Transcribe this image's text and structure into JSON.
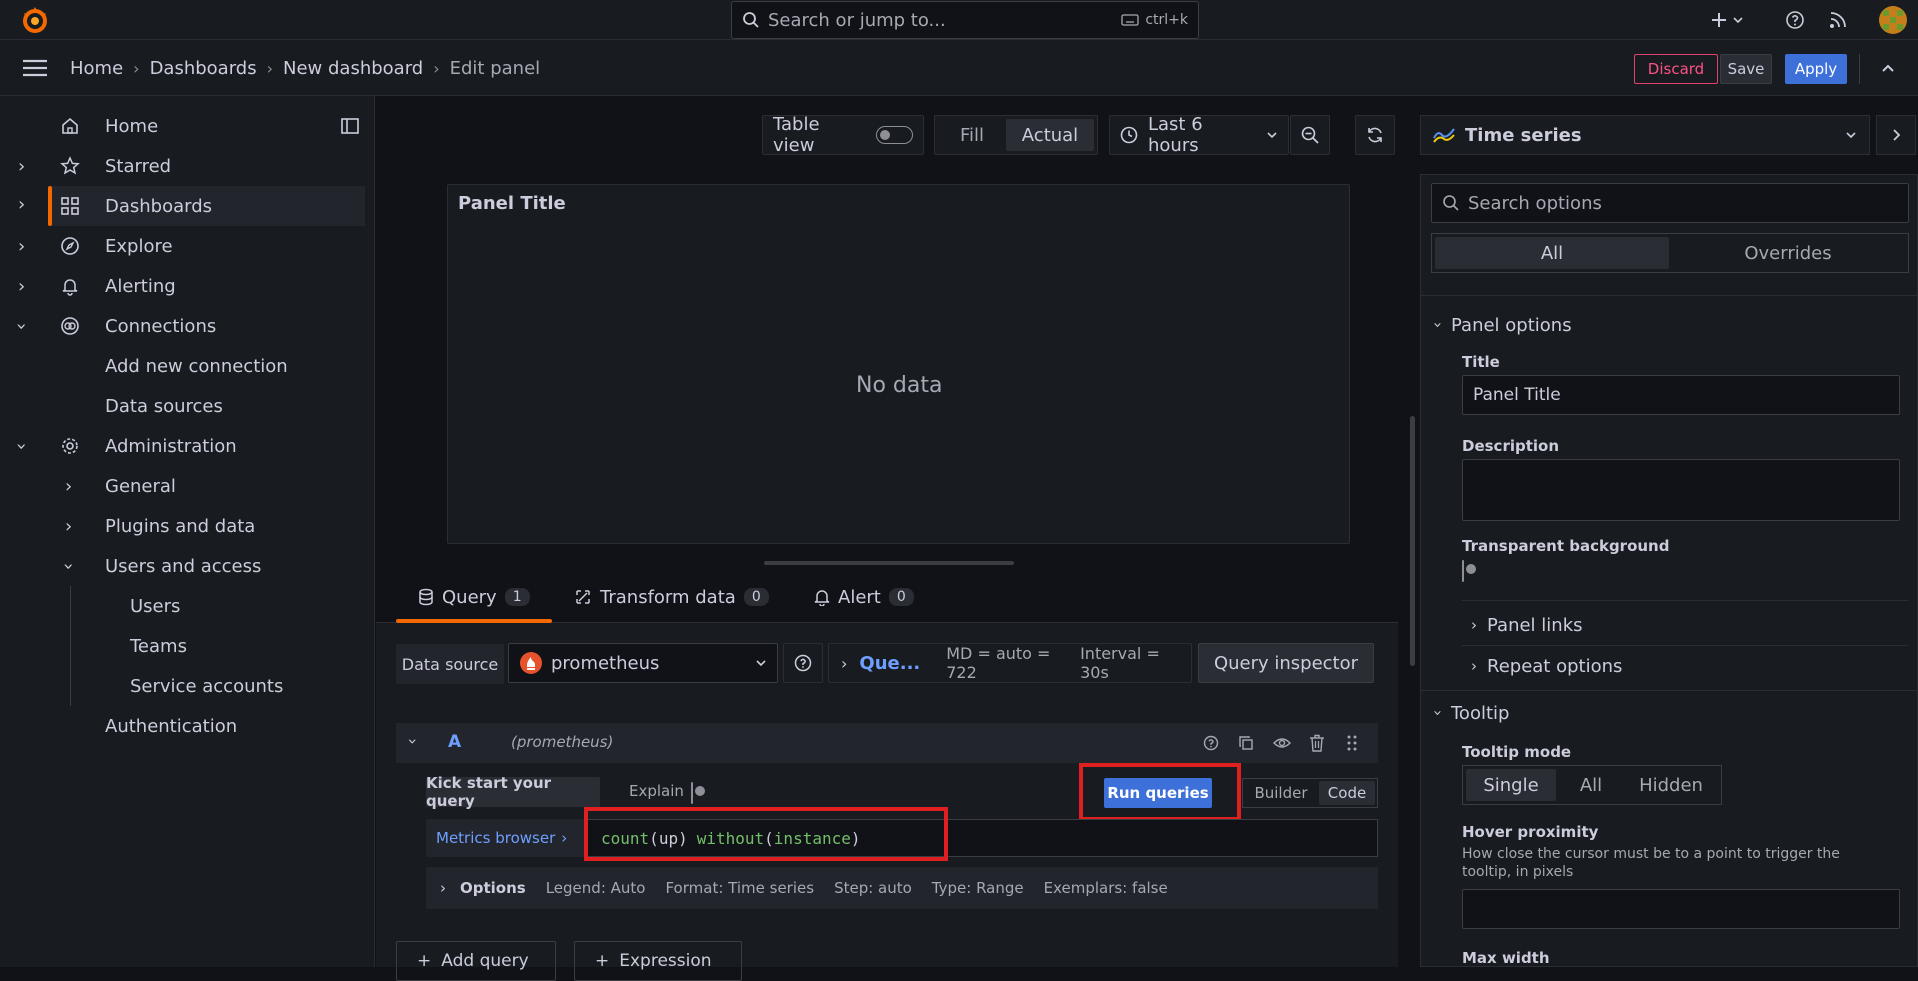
{
  "topbar": {
    "search_placeholder": "Search or jump to...",
    "shortcut": "ctrl+k"
  },
  "breadcrumb": [
    "Home",
    "Dashboards",
    "New dashboard",
    "Edit panel"
  ],
  "actions": {
    "discard": "Discard",
    "save": "Save",
    "apply": "Apply"
  },
  "sidebar": {
    "items": [
      {
        "label": "Home"
      },
      {
        "label": "Starred"
      },
      {
        "label": "Dashboards"
      },
      {
        "label": "Explore"
      },
      {
        "label": "Alerting"
      },
      {
        "label": "Connections"
      },
      {
        "label": "Add new connection"
      },
      {
        "label": "Data sources"
      },
      {
        "label": "Administration"
      },
      {
        "label": "General"
      },
      {
        "label": "Plugins and data"
      },
      {
        "label": "Users and access"
      },
      {
        "label": "Users"
      },
      {
        "label": "Teams"
      },
      {
        "label": "Service accounts"
      },
      {
        "label": "Authentication"
      }
    ]
  },
  "toolbar": {
    "table_view": "Table view",
    "fill": "Fill",
    "actual": "Actual",
    "time_range": "Last 6 hours"
  },
  "panel": {
    "title": "Panel Title",
    "empty": "No data"
  },
  "tabs": [
    {
      "label": "Query",
      "count": "1"
    },
    {
      "label": "Transform data",
      "count": "0"
    },
    {
      "label": "Alert",
      "count": "0"
    }
  ],
  "query": {
    "datasource_label": "Data source",
    "datasource": "prometheus",
    "query_options": "Que...",
    "md": "MD = auto = 722",
    "interval": "Interval = 30s",
    "inspector": "Query inspector",
    "row_letter": "A",
    "row_ds": "(prometheus)",
    "kickstart": "Kick start your query",
    "explain": "Explain",
    "run": "Run queries",
    "builder": "Builder",
    "code": "Code",
    "metrics_browser": "Metrics browser",
    "expr": {
      "fn1": "count",
      "p1": "(",
      "arg": "up",
      "p2": ")",
      "kw": "without",
      "p3": "(",
      "lbl": "instance",
      "p4": ")"
    },
    "options_label": "Options",
    "legend": "Legend: Auto",
    "format": "Format: Time series",
    "step": "Step: auto",
    "type": "Type: Range",
    "exemplars": "Exemplars: false",
    "add_query": "Add query",
    "expression": "Expression"
  },
  "options": {
    "viz": "Time series",
    "search_placeholder": "Search options",
    "all": "All",
    "overrides": "Overrides",
    "panel_options": "Panel options",
    "title_label": "Title",
    "title_value": "Panel Title",
    "description_label": "Description",
    "transparent": "Transparent background",
    "panel_links": "Panel links",
    "repeat_options": "Repeat options",
    "tooltip": "Tooltip",
    "tooltip_mode": "Tooltip mode",
    "mode_single": "Single",
    "mode_all": "All",
    "mode_hidden": "Hidden",
    "hover_proximity": "Hover proximity",
    "hover_desc": "How close the cursor must be to a point to trigger the tooltip, in pixels",
    "max_width": "Max width"
  },
  "colors": {
    "accent": "#3d71d9",
    "highlight": "#e02020",
    "brand": "#f46800"
  }
}
